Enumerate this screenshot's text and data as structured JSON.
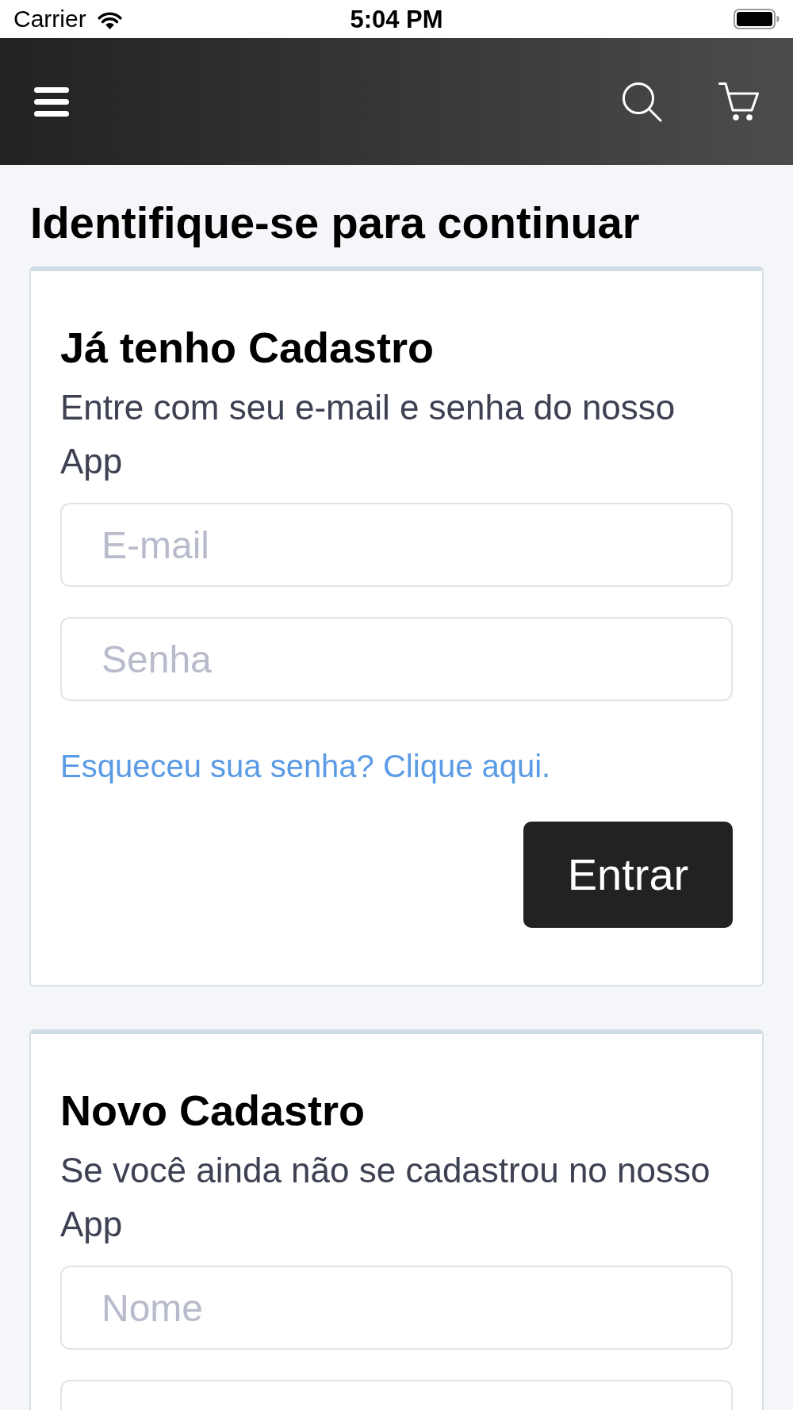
{
  "status_bar": {
    "carrier": "Carrier",
    "time": "5:04 PM"
  },
  "page_title": "Identifique-se para continuar",
  "cards": [
    {
      "title": "Já tenho Cadastro",
      "description": "Entre com seu e-mail e senha do nosso App",
      "fields": [
        {
          "placeholder": "E-mail"
        },
        {
          "placeholder": "Senha"
        }
      ],
      "link": "Esqueceu sua senha? Clique aqui.",
      "button": "Entrar"
    },
    {
      "title": "Novo Cadastro",
      "description": "Se você ainda não se cadastrou no nosso App",
      "fields": [
        {
          "placeholder": "Nome"
        }
      ],
      "more_fields_below": true
    }
  ]
}
